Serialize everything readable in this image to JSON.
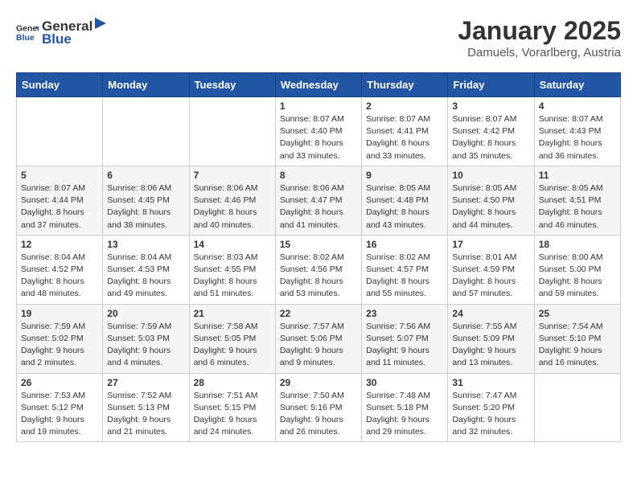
{
  "logo": {
    "general": "General",
    "blue": "Blue"
  },
  "title": "January 2025",
  "subtitle": "Damuels, Vorarlberg, Austria",
  "weekdays": [
    "Sunday",
    "Monday",
    "Tuesday",
    "Wednesday",
    "Thursday",
    "Friday",
    "Saturday"
  ],
  "weeks": [
    [
      {
        "day": "",
        "info": ""
      },
      {
        "day": "",
        "info": ""
      },
      {
        "day": "",
        "info": ""
      },
      {
        "day": "1",
        "info": "Sunrise: 8:07 AM\nSunset: 4:40 PM\nDaylight: 8 hours\nand 33 minutes."
      },
      {
        "day": "2",
        "info": "Sunrise: 8:07 AM\nSunset: 4:41 PM\nDaylight: 8 hours\nand 33 minutes."
      },
      {
        "day": "3",
        "info": "Sunrise: 8:07 AM\nSunset: 4:42 PM\nDaylight: 8 hours\nand 35 minutes."
      },
      {
        "day": "4",
        "info": "Sunrise: 8:07 AM\nSunset: 4:43 PM\nDaylight: 8 hours\nand 36 minutes."
      }
    ],
    [
      {
        "day": "5",
        "info": "Sunrise: 8:07 AM\nSunset: 4:44 PM\nDaylight: 8 hours\nand 37 minutes."
      },
      {
        "day": "6",
        "info": "Sunrise: 8:06 AM\nSunset: 4:45 PM\nDaylight: 8 hours\nand 38 minutes."
      },
      {
        "day": "7",
        "info": "Sunrise: 8:06 AM\nSunset: 4:46 PM\nDaylight: 8 hours\nand 40 minutes."
      },
      {
        "day": "8",
        "info": "Sunrise: 8:06 AM\nSunset: 4:47 PM\nDaylight: 8 hours\nand 41 minutes."
      },
      {
        "day": "9",
        "info": "Sunrise: 8:05 AM\nSunset: 4:48 PM\nDaylight: 8 hours\nand 43 minutes."
      },
      {
        "day": "10",
        "info": "Sunrise: 8:05 AM\nSunset: 4:50 PM\nDaylight: 8 hours\nand 44 minutes."
      },
      {
        "day": "11",
        "info": "Sunrise: 8:05 AM\nSunset: 4:51 PM\nDaylight: 8 hours\nand 46 minutes."
      }
    ],
    [
      {
        "day": "12",
        "info": "Sunrise: 8:04 AM\nSunset: 4:52 PM\nDaylight: 8 hours\nand 48 minutes."
      },
      {
        "day": "13",
        "info": "Sunrise: 8:04 AM\nSunset: 4:53 PM\nDaylight: 8 hours\nand 49 minutes."
      },
      {
        "day": "14",
        "info": "Sunrise: 8:03 AM\nSunset: 4:55 PM\nDaylight: 8 hours\nand 51 minutes."
      },
      {
        "day": "15",
        "info": "Sunrise: 8:02 AM\nSunset: 4:56 PM\nDaylight: 8 hours\nand 53 minutes."
      },
      {
        "day": "16",
        "info": "Sunrise: 8:02 AM\nSunset: 4:57 PM\nDaylight: 8 hours\nand 55 minutes."
      },
      {
        "day": "17",
        "info": "Sunrise: 8:01 AM\nSunset: 4:59 PM\nDaylight: 8 hours\nand 57 minutes."
      },
      {
        "day": "18",
        "info": "Sunrise: 8:00 AM\nSunset: 5:00 PM\nDaylight: 8 hours\nand 59 minutes."
      }
    ],
    [
      {
        "day": "19",
        "info": "Sunrise: 7:59 AM\nSunset: 5:02 PM\nDaylight: 9 hours\nand 2 minutes."
      },
      {
        "day": "20",
        "info": "Sunrise: 7:59 AM\nSunset: 5:03 PM\nDaylight: 9 hours\nand 4 minutes."
      },
      {
        "day": "21",
        "info": "Sunrise: 7:58 AM\nSunset: 5:05 PM\nDaylight: 9 hours\nand 6 minutes."
      },
      {
        "day": "22",
        "info": "Sunrise: 7:57 AM\nSunset: 5:06 PM\nDaylight: 9 hours\nand 9 minutes."
      },
      {
        "day": "23",
        "info": "Sunrise: 7:56 AM\nSunset: 5:07 PM\nDaylight: 9 hours\nand 11 minutes."
      },
      {
        "day": "24",
        "info": "Sunrise: 7:55 AM\nSunset: 5:09 PM\nDaylight: 9 hours\nand 13 minutes."
      },
      {
        "day": "25",
        "info": "Sunrise: 7:54 AM\nSunset: 5:10 PM\nDaylight: 9 hours\nand 16 minutes."
      }
    ],
    [
      {
        "day": "26",
        "info": "Sunrise: 7:53 AM\nSunset: 5:12 PM\nDaylight: 9 hours\nand 19 minutes."
      },
      {
        "day": "27",
        "info": "Sunrise: 7:52 AM\nSunset: 5:13 PM\nDaylight: 9 hours\nand 21 minutes."
      },
      {
        "day": "28",
        "info": "Sunrise: 7:51 AM\nSunset: 5:15 PM\nDaylight: 9 hours\nand 24 minutes."
      },
      {
        "day": "29",
        "info": "Sunrise: 7:50 AM\nSunset: 5:16 PM\nDaylight: 9 hours\nand 26 minutes."
      },
      {
        "day": "30",
        "info": "Sunrise: 7:48 AM\nSunset: 5:18 PM\nDaylight: 9 hours\nand 29 minutes."
      },
      {
        "day": "31",
        "info": "Sunrise: 7:47 AM\nSunset: 5:20 PM\nDaylight: 9 hours\nand 32 minutes."
      },
      {
        "day": "",
        "info": ""
      }
    ]
  ]
}
